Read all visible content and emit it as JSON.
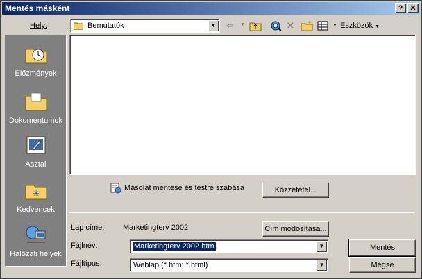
{
  "window": {
    "title": "Mentés másként",
    "help_label": "?",
    "close_label": "✕"
  },
  "toolbar": {
    "location_label": "Hely:",
    "location_value": "Bemutatók",
    "tools_label": "Eszközök"
  },
  "places_bar": [
    {
      "label": "Előzmények",
      "icon": "history-clock-folder-icon"
    },
    {
      "label": "Dokumentumok",
      "icon": "documents-folder-icon"
    },
    {
      "label": "Asztal",
      "icon": "desktop-icon"
    },
    {
      "label": "Kedvencek",
      "icon": "favorites-folder-icon"
    },
    {
      "label": "Hálózati helyek",
      "icon": "network-places-icon"
    }
  ],
  "publish": {
    "copy_link_label": "Másolat mentése és testre szabása",
    "publish_button": "Közzététel..."
  },
  "page_title": {
    "label": "Lap címe:",
    "value": "Marketingterv 2002",
    "change_button": "Cím módosítása..."
  },
  "filename": {
    "label": "Fájlnév:",
    "value": "Marketingterv 2002.htm"
  },
  "filetype": {
    "label": "Fájltípus:",
    "value": "Weblap (*.htm; *.html)"
  },
  "actions": {
    "save": "Mentés",
    "cancel": "Mégse"
  }
}
